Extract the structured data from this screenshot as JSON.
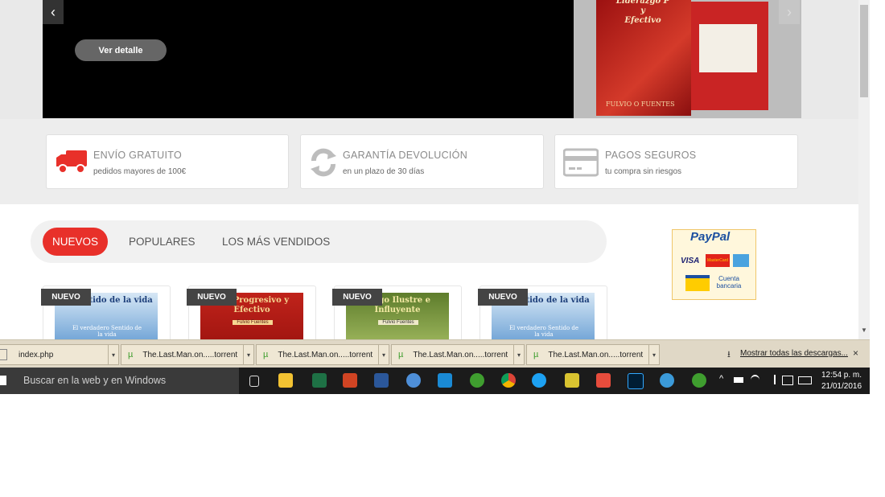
{
  "slider": {
    "prev_arrow": "‹",
    "next_arrow": "›",
    "detail_button": "Ver detalle",
    "book_title_line1": "Liderazgo P",
    "book_title_line2": "y",
    "book_title_line3": "Efectivo",
    "book_author": "FULVIO O FUENTES"
  },
  "features": [
    {
      "icon": "truck-icon",
      "title": "ENVÍO GRATUITO",
      "subtitle": "pedidos mayores de 100€"
    },
    {
      "icon": "refresh-icon",
      "title": "GARANTÍA DEVOLUCIÓN",
      "subtitle": "en un plazo de 30 días"
    },
    {
      "icon": "credit-card-icon",
      "title": "PAGOS SEGUROS",
      "subtitle": "tu compra sin riesgos"
    }
  ],
  "tabs": [
    "NUEVOS",
    "POPULARES",
    "LOS MÁS VENDIDOS"
  ],
  "active_tab": "NUEVOS",
  "paypal": {
    "logo": "PayPal",
    "cards": [
      "VISA",
      "MasterCard"
    ],
    "bank_label": "Cuenta bancaria"
  },
  "products": [
    {
      "badge": "NUEVO",
      "cover_text": "ro Sentido de la vida",
      "sub": "El verdadero Sentido de la vida"
    },
    {
      "badge": "NUEVO",
      "cover_text": "zgo Progresivo y Efectivo",
      "sub": "Fulvio Fuentes"
    },
    {
      "badge": "NUEVO",
      "cover_text": "razgo Ilustre e Influyente",
      "sub": "Fulvio Fuentes"
    },
    {
      "badge": "NUEVO",
      "cover_text": "ro Sentido de la vida",
      "sub": "El verdadero Sentido de la vida"
    }
  ],
  "downloads": {
    "items": [
      "index.php",
      "The.Last.Man.on.....torrent",
      "The.Last.Man.on.....torrent",
      "The.Last.Man.on.....torrent",
      "The.Last.Man.on.....torrent"
    ],
    "show_all": "Mostrar todas las descargas...",
    "close": "×"
  },
  "taskbar": {
    "search_placeholder": "Buscar en la web y en Windows",
    "time": "12:54 p. m.",
    "date": "21/01/2016",
    "colors": {
      "excel": "#1e7145",
      "powerpoint": "#d04423",
      "word": "#2b579a",
      "photoshop": "#001d34",
      "utorrent": "#3f9e2f",
      "chrome": "#db4437"
    }
  }
}
